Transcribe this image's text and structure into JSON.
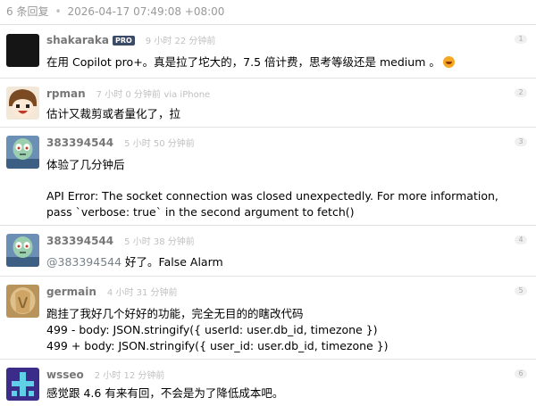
{
  "header": {
    "reply_count": "6 条回复",
    "separator": "•",
    "timestamp": "2026-04-17 07:49:08 +08:00"
  },
  "replies": [
    {
      "username": "shakaraka",
      "badge": "PRO",
      "time_ago": "9 小时 22 分钟前",
      "floor": "1",
      "content": "在用 Copilot pro+。真是拉了坨大的，7.5 倍计费，思考等级还是 medium 。",
      "emoji_icon": "rofl-emoji"
    },
    {
      "username": "rpman",
      "time_ago": "7 小时 0 分钟前",
      "via": "via iPhone",
      "floor": "2",
      "content": "估计又裁剪或者量化了，拉"
    },
    {
      "username": "383394544",
      "time_ago": "5 小时 50 分钟前",
      "floor": "3",
      "content_line1": "体验了几分钟后",
      "content_line2": "API Error: The socket connection was closed unexpectedly. For more information, pass `verbose: true` in the second argument to fetch()"
    },
    {
      "username": "383394544",
      "time_ago": "5 小时 38 分钟前",
      "floor": "4",
      "mention": "@383394544",
      "content": " 好了。False Alarm"
    },
    {
      "username": "germain",
      "time_ago": "4 小时 31 分钟前",
      "floor": "5",
      "lines": [
        "跑挂了我好几个好好的功能，完全无目的的瞎改代码",
        "499 - body: JSON.stringify({ userId: user.db_id, timezone })",
        "499 + body: JSON.stringify({ user_id: user.db_id, timezone })"
      ]
    },
    {
      "username": "wsseo",
      "time_ago": "2 小时 12 分钟前",
      "floor": "6",
      "content": "感觉跟 4.6 有来有回，不会是为了降低成本吧。"
    }
  ]
}
